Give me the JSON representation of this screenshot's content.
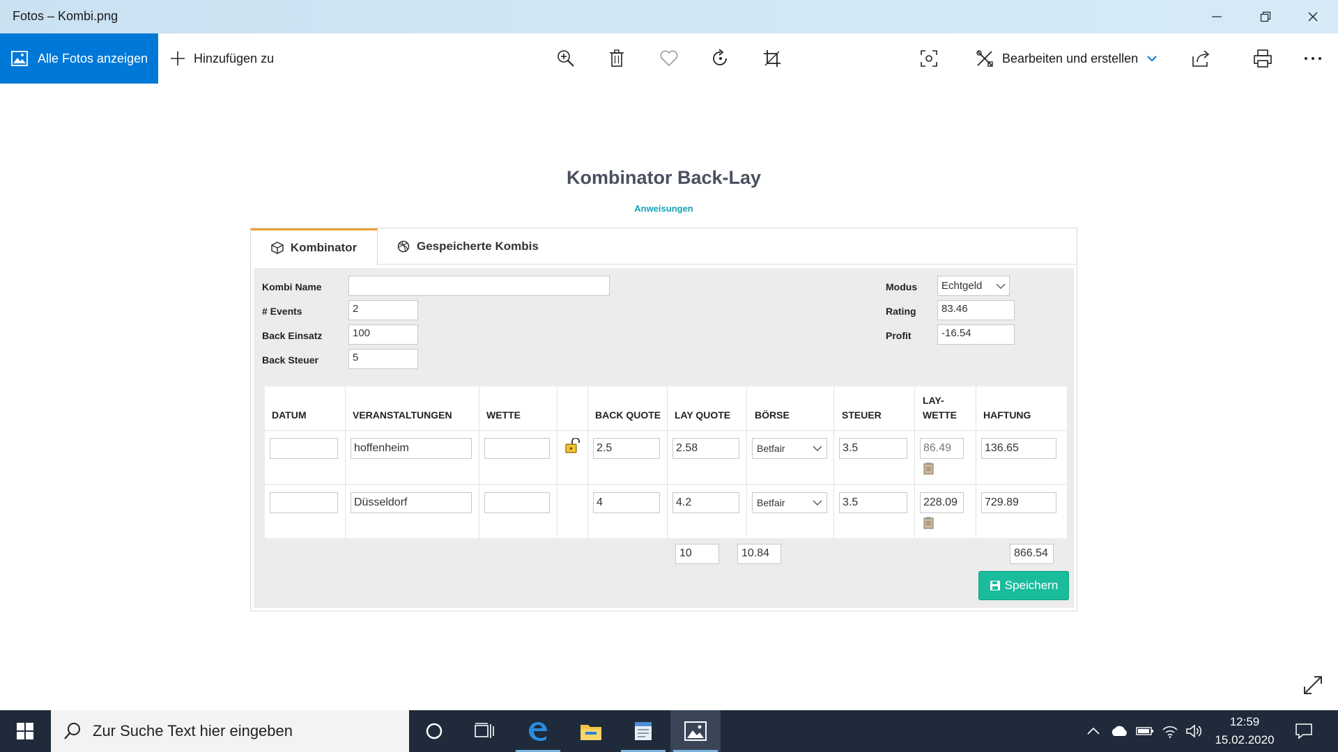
{
  "window": {
    "title": "Fotos – Kombi.png"
  },
  "toolbar": {
    "all_photos": "Alle Fotos anzeigen",
    "add_to": "Hinzufügen zu",
    "edit_create": "Bearbeiten und erstellen"
  },
  "page": {
    "title": "Kombinator Back-Lay",
    "link": "Anweisungen"
  },
  "tabs": [
    {
      "label": "Kombinator",
      "active": true
    },
    {
      "label": "Gespeicherte Kombis",
      "active": false
    }
  ],
  "form": {
    "kombi_name_label": "Kombi Name",
    "kombi_name_value": "",
    "events_label": "# Events",
    "events_value": "2",
    "back_einsatz_label": "Back Einsatz",
    "back_einsatz_value": "100",
    "back_steuer_label": "Back Steuer",
    "back_steuer_value": "5",
    "modus_label": "Modus",
    "modus_value": "Echtgeld",
    "rating_label": "Rating",
    "rating_value": "83.46",
    "profit_label": "Profit",
    "profit_value": "-16.54"
  },
  "table": {
    "headers": {
      "datum": "DATUM",
      "veranstaltungen": "VERANSTALTUNGEN",
      "wette": "WETTE",
      "back_quote": "BACK QUOTE",
      "lay_quote": "LAY QUOTE",
      "boerse": "BÖRSE",
      "steuer": "STEUER",
      "lay_wette_1": "LAY-",
      "lay_wette_2": "WETTE",
      "haftung": "HAFTUNG"
    },
    "rows": [
      {
        "datum": "",
        "veranstaltung": "hoffenheim",
        "wette": "",
        "back_quote": "2.5",
        "lay_quote": "2.58",
        "boerse": "Betfair",
        "steuer": "3.5",
        "lay_wette": "86.49",
        "haftung": "136.65"
      },
      {
        "datum": "",
        "veranstaltung": "Düsseldorf",
        "wette": "",
        "back_quote": "4",
        "lay_quote": "4.2",
        "boerse": "Betfair",
        "steuer": "3.5",
        "lay_wette": "228.09",
        "haftung": "729.89"
      }
    ],
    "footer": {
      "back_total": "10",
      "lay_total": "10.84",
      "haftung_total": "866.54"
    }
  },
  "save_button": "Speichern",
  "taskbar": {
    "search_placeholder": "Zur Suche Text hier eingeben",
    "time": "12:59",
    "date": "15.02.2020"
  },
  "colors": {
    "accent_blue": "#0078d7",
    "title_text": "#4a5060",
    "link_teal": "#17a2b8",
    "tab_active_border": "#f0a030",
    "save_green": "#1abc9c",
    "taskbar": "#1f2a3a"
  }
}
